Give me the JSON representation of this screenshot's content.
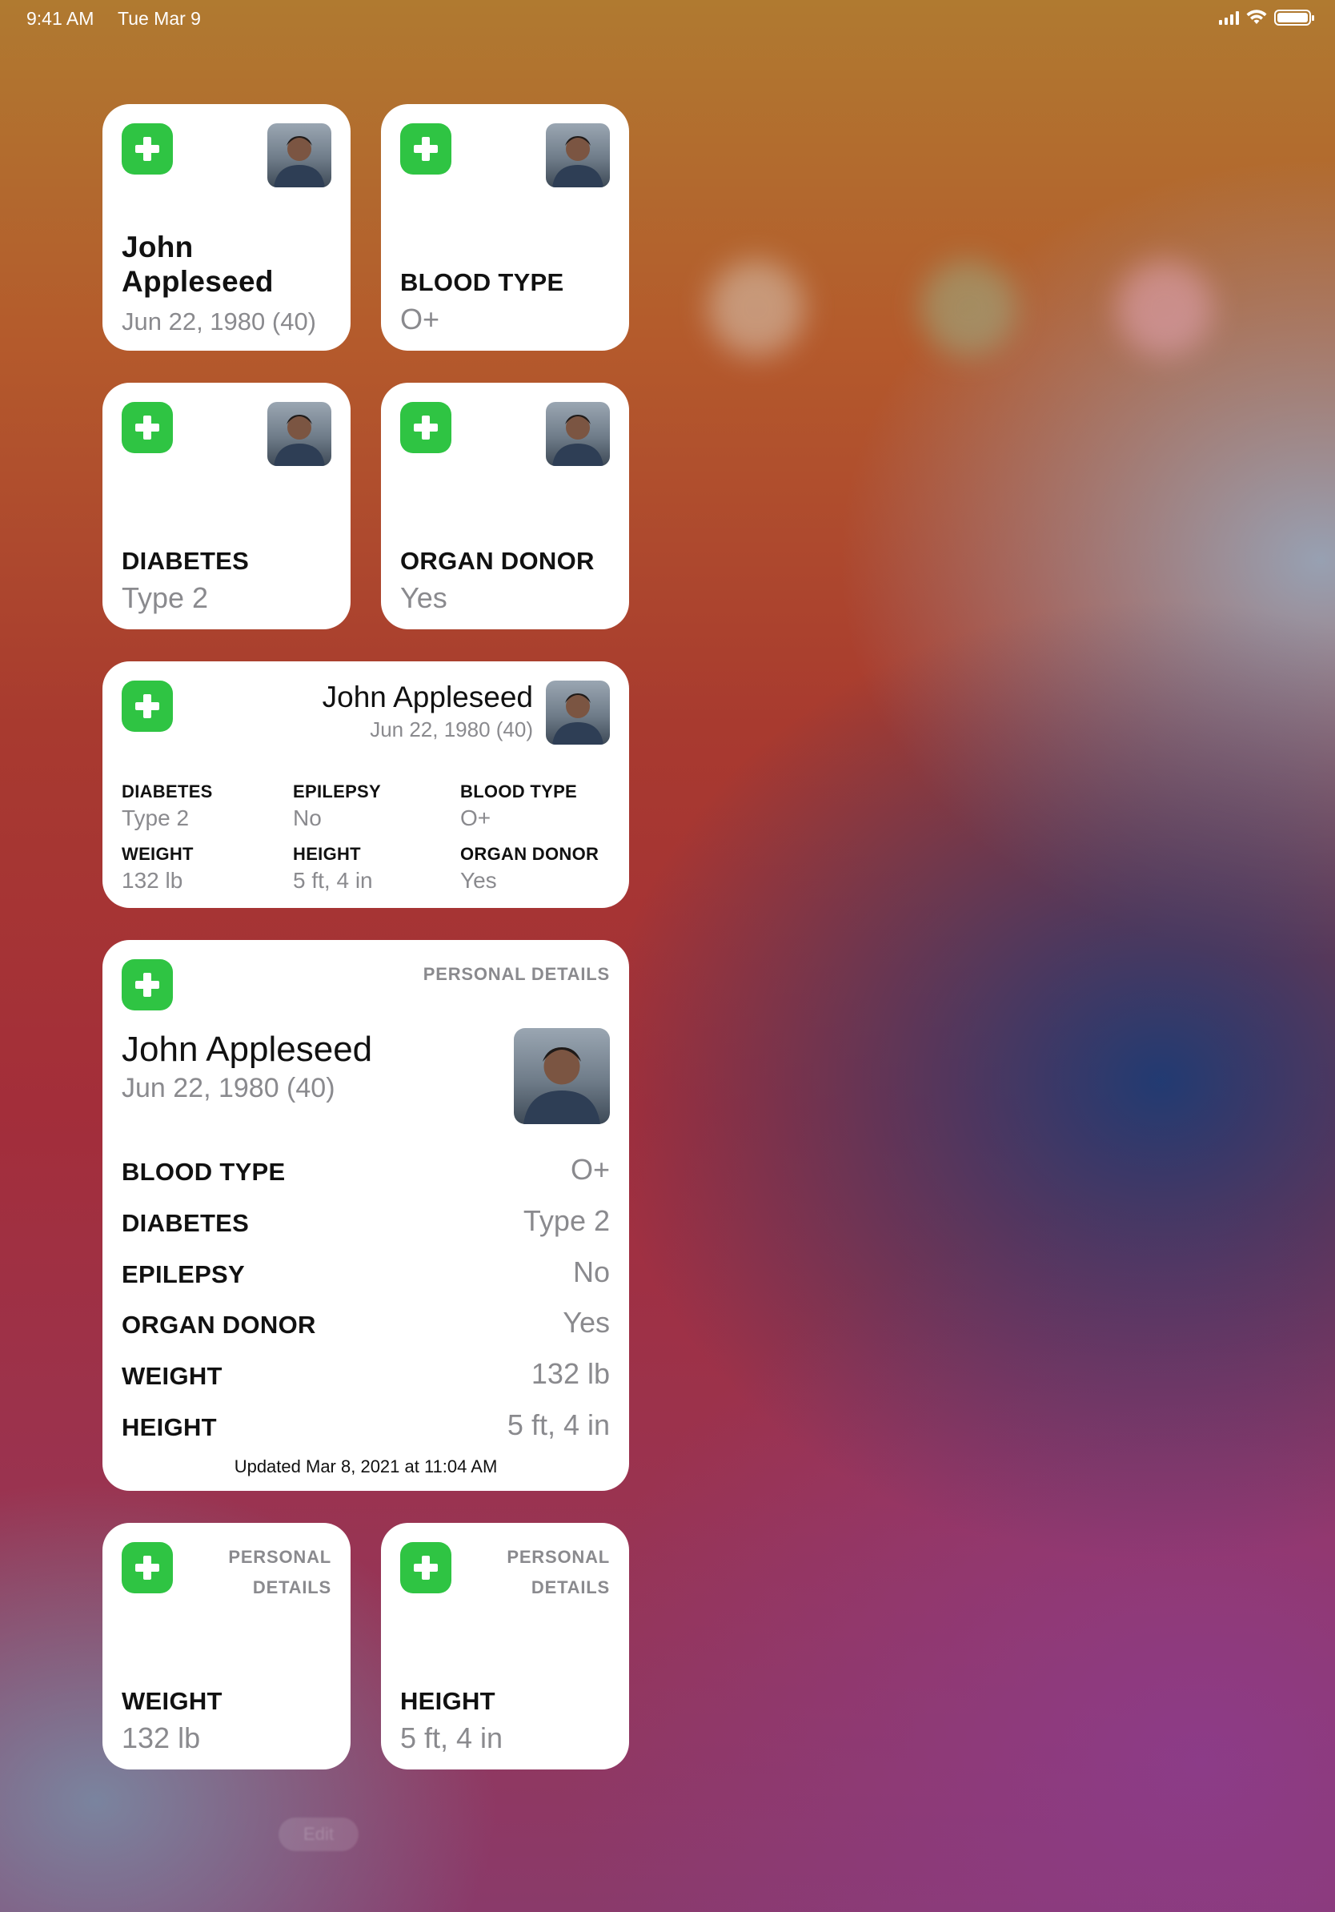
{
  "status_bar": {
    "time": "9:41 AM",
    "date": "Tue Mar 9"
  },
  "colors": {
    "medical_green": "#2fc443",
    "label_gray": "#8a8a8e"
  },
  "icons": [
    "medical-id-plus-icon",
    "avatar-photo",
    "signal-icon",
    "wifi-icon",
    "battery-icon"
  ],
  "widget_name": {
    "first": "John",
    "last": "Appleseed",
    "dob": "Jun 22, 1980 (40)"
  },
  "widget_blood": {
    "label": "BLOOD TYPE",
    "value": "O+"
  },
  "widget_diabetes": {
    "label": "DIABETES",
    "value": "Type 2"
  },
  "widget_organ": {
    "label": "ORGAN DONOR",
    "value": "Yes"
  },
  "widget_medium": {
    "name": "John Appleseed",
    "dob": "Jun 22, 1980 (40)",
    "items": [
      {
        "label": "DIABETES",
        "value": "Type 2"
      },
      {
        "label": "EPILEPSY",
        "value": "No"
      },
      {
        "label": "BLOOD TYPE",
        "value": "O+"
      },
      {
        "label": "WEIGHT",
        "value": "132 lb"
      },
      {
        "label": "HEIGHT",
        "value": "5 ft, 4 in"
      },
      {
        "label": "ORGAN DONOR",
        "value": "Yes"
      }
    ]
  },
  "widget_large": {
    "section": "PERSONAL DETAILS",
    "name": "John Appleseed",
    "dob": "Jun 22, 1980 (40)",
    "rows": [
      {
        "label": "BLOOD TYPE",
        "value": "O+"
      },
      {
        "label": "DIABETES",
        "value": "Type 2"
      },
      {
        "label": "EPILEPSY",
        "value": "No"
      },
      {
        "label": "ORGAN DONOR",
        "value": "Yes"
      },
      {
        "label": "WEIGHT",
        "value": "132 lb"
      },
      {
        "label": "HEIGHT",
        "value": "5 ft, 4 in"
      }
    ],
    "updated": "Updated Mar 8, 2021 at 11:04 AM"
  },
  "widget_weight": {
    "section_line1": "PERSONAL",
    "section_line2": "DETAILS",
    "label": "WEIGHT",
    "value": "132 lb"
  },
  "widget_height": {
    "section_line1": "PERSONAL",
    "section_line2": "DETAILS",
    "label": "HEIGHT",
    "value": "5 ft, 4 in"
  },
  "edit_button": {
    "label": "Edit"
  }
}
